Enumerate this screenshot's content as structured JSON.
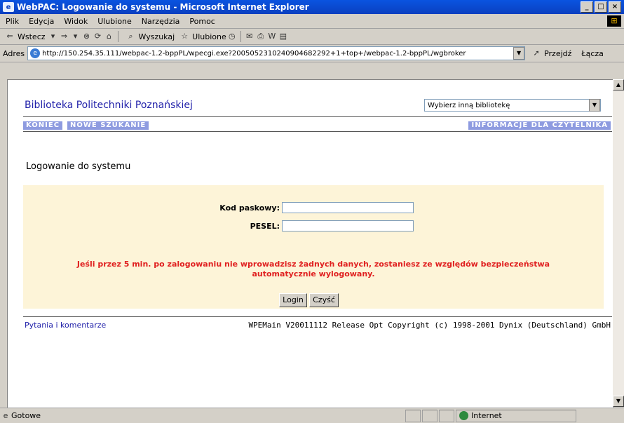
{
  "window": {
    "title": "WebPAC: Logowanie do systemu - Microsoft Internet Explorer"
  },
  "menu": [
    "Plik",
    "Edycja",
    "Widok",
    "Ulubione",
    "Narzędzia",
    "Pomoc"
  ],
  "toolbar": {
    "back": "Wstecz",
    "search": "Wyszukaj",
    "favorites": "Ulubione"
  },
  "address": {
    "label": "Adres",
    "url": "http://150.254.35.111/webpac-1.2-bppPL/wpecgi.exe?2005052310240904682292+1+top+/webpac-1.2-bppPL/wgbroker",
    "go": "Przejdź",
    "links": "Łącza"
  },
  "page": {
    "library_name": "Biblioteka Politechniki Poznańskiej",
    "library_select": "Wybierz inną bibliotekę",
    "nav": {
      "exit": "KONIEC",
      "new_search": "NOWE SZUKANIE",
      "reader_info": "INFORMACJE DLA CZYTELNIKA"
    },
    "heading": "Logowanie do systemu",
    "form": {
      "barcode_label": "Kod paskowy:",
      "barcode_value": "",
      "pesel_label": "PESEL:",
      "pesel_value": "",
      "warning_line1": "Jeśli przez 5 min. po zalogowaniu nie wprowadzisz żadnych danych, zostaniesz ze względów bezpieczeństwa",
      "warning_line2": "automatycznie wylogowany.",
      "login_label": "Login",
      "clear_label": "Czyść"
    },
    "footer": {
      "questions": "Pytania i komentarze",
      "copyright": "WPEMain V20011112 Release Opt Copyright (c) 1998-2001 Dynix (Deutschland) GmbH"
    }
  },
  "status": {
    "text": "Gotowe",
    "zone": "Internet"
  }
}
